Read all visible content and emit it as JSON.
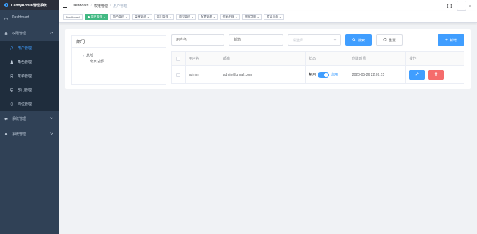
{
  "app": {
    "title": "CandyAdmin管理系统"
  },
  "sidebar": {
    "items": [
      {
        "label": "Dashboard",
        "icon": "dashboard-icon"
      },
      {
        "label": "权限管理",
        "icon": "lock-icon",
        "expanded": true,
        "children": [
          {
            "label": "用户管理",
            "icon": "user-icon",
            "active": true
          },
          {
            "label": "角色管理",
            "icon": "user-role-icon"
          },
          {
            "label": "菜单管理",
            "icon": "bookmark-icon"
          },
          {
            "label": "部门管理",
            "icon": "monitor-icon"
          },
          {
            "label": "岗位管理",
            "icon": "gear-icon"
          }
        ]
      },
      {
        "label": "系统管理",
        "icon": "chat-icon"
      },
      {
        "label": "系统管理",
        "icon": "settings-icon"
      }
    ]
  },
  "navbar": {
    "breadcrumbs": [
      "Dashboard",
      "权限管理",
      "用户管理"
    ]
  },
  "tags": [
    {
      "label": "Dashboard",
      "active": false,
      "closable": false
    },
    {
      "label": "用户管理",
      "active": true,
      "closable": true
    },
    {
      "label": "角色管理",
      "active": false,
      "closable": true
    },
    {
      "label": "菜单管理",
      "active": false,
      "closable": true
    },
    {
      "label": "部门管理",
      "active": false,
      "closable": true
    },
    {
      "label": "岗位管理",
      "active": false,
      "closable": true
    },
    {
      "label": "配置管理",
      "active": false,
      "closable": true
    },
    {
      "label": "代码生成",
      "active": false,
      "closable": true
    },
    {
      "label": "数据字典",
      "active": false,
      "closable": true
    },
    {
      "label": "错误页面",
      "active": false,
      "closable": true
    }
  ],
  "tree": {
    "title": "部门",
    "nodes": [
      {
        "label": "总部",
        "children": [
          {
            "label": "南京总部"
          }
        ]
      }
    ]
  },
  "search": {
    "username_placeholder": "用户名",
    "email_placeholder": "邮箱",
    "status_placeholder": "请选择",
    "search_label": "搜索",
    "reset_label": "重置",
    "add_label": "新增"
  },
  "table": {
    "headers": [
      "用户名",
      "邮箱",
      "状态",
      "创建时间",
      "操作"
    ],
    "rows": [
      {
        "username": "admin",
        "email": "admin@gmail.com",
        "status_off": "禁用",
        "status_on": "启用",
        "status": true,
        "created": "2020-05-26 22:09:15"
      }
    ]
  },
  "colors": {
    "sidebar_bg": "#304156",
    "primary": "#409eff",
    "active_tag": "#42b983",
    "danger": "#f56c6c"
  }
}
